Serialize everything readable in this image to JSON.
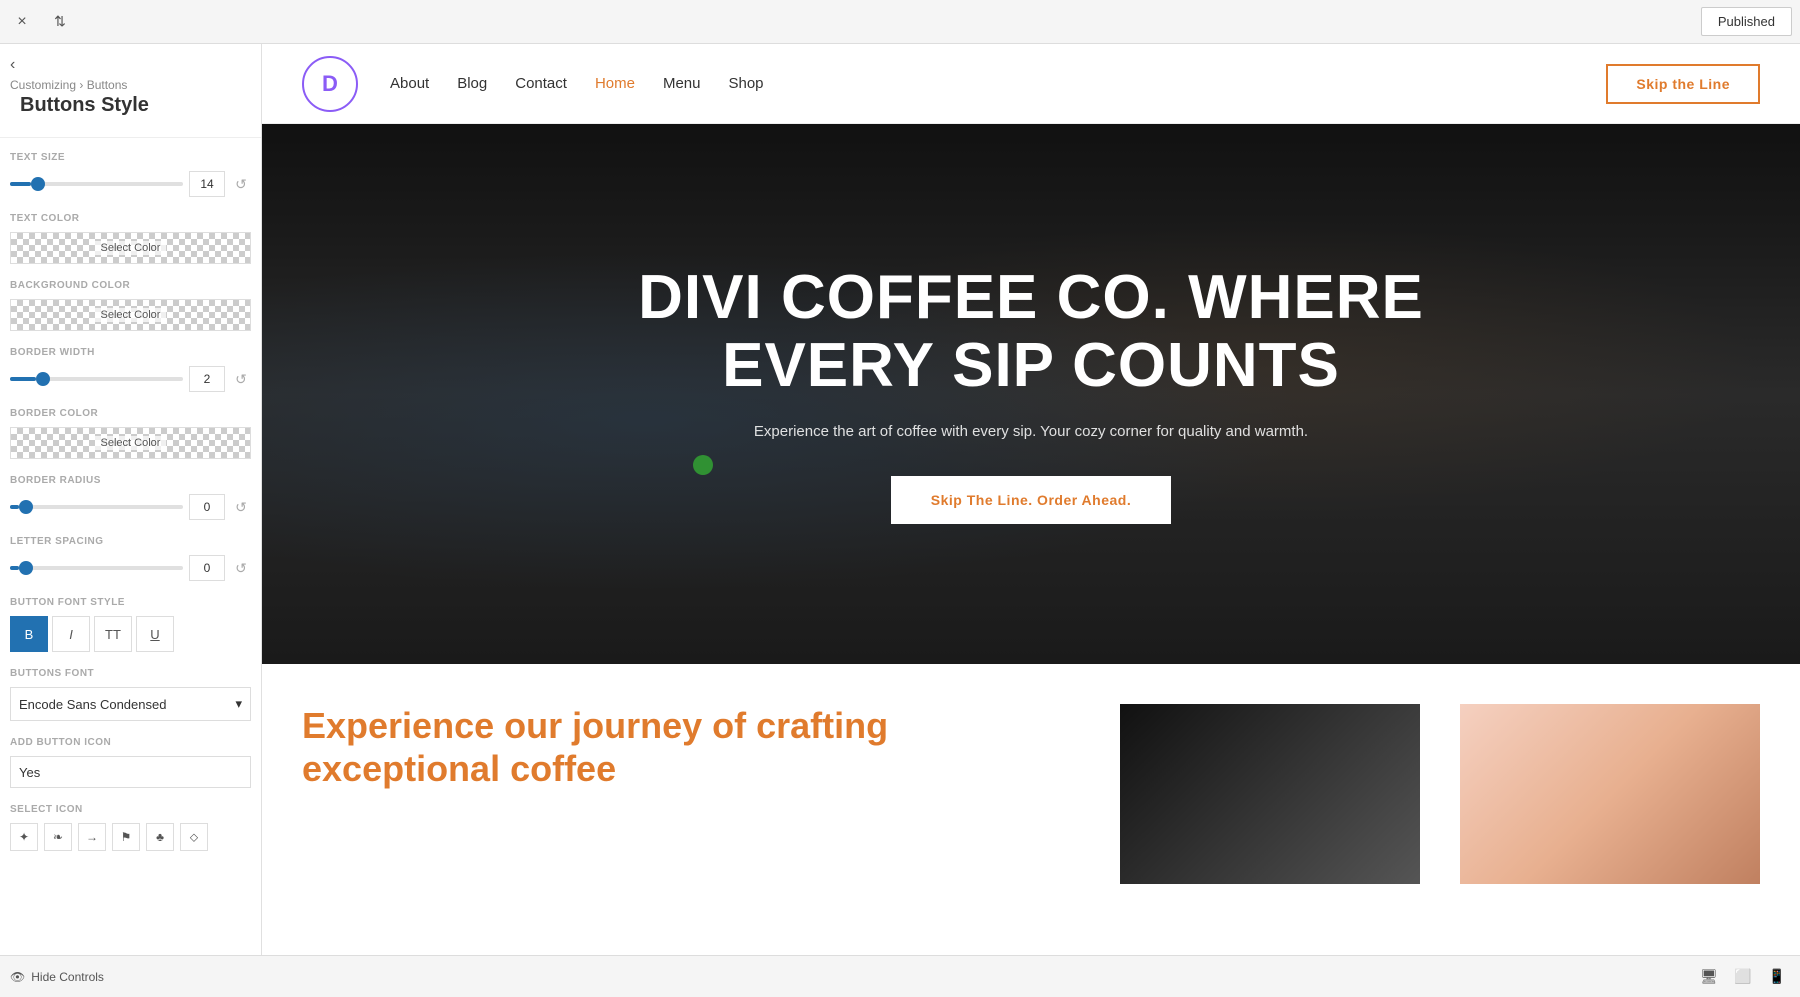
{
  "toolbar": {
    "close_label": "×",
    "arrows_label": "⇅",
    "published_label": "Published"
  },
  "panel": {
    "back_arrow": "‹",
    "breadcrumb": "Customizing › Buttons",
    "title": "Buttons Style",
    "sections": {
      "text_size": {
        "label": "TEXT SIZE",
        "value": "14",
        "slider_percent": 12
      },
      "text_color": {
        "label": "TEXT COLOR",
        "swatch_label": "Select Color"
      },
      "background_color": {
        "label": "BACKGROUND COLOR",
        "swatch_label": "Select Color"
      },
      "border_width": {
        "label": "BORDER WIDTH",
        "value": "2",
        "slider_percent": 15
      },
      "border_color": {
        "label": "BORDER COLOR",
        "swatch_label": "Select Color"
      },
      "border_radius": {
        "label": "BORDER RADIUS",
        "value": "0",
        "slider_percent": 5
      },
      "letter_spacing": {
        "label": "LETTER SPACING",
        "value": "0",
        "slider_percent": 5
      },
      "button_font_style": {
        "label": "BUTTON FONT STYLE",
        "bold": "B",
        "italic": "I",
        "all_caps": "TT",
        "underline": "U"
      },
      "buttons_font": {
        "label": "BUTTONS FONT",
        "value": "Encode Sans Condensed",
        "arrow": "▾"
      },
      "add_button_icon": {
        "label": "ADD BUTTON ICON",
        "value": "Yes"
      },
      "select_icon": {
        "label": "SELECT ICON"
      }
    }
  },
  "bottom_bar": {
    "hide_controls": "Hide Controls",
    "desktop_icon": "🖥",
    "tablet_icon": "⬜",
    "mobile_icon": "📱"
  },
  "site": {
    "nav": {
      "logo": "D",
      "links": [
        "About",
        "Blog",
        "Contact",
        "Home",
        "Menu",
        "Shop"
      ],
      "active_link": "Home",
      "cta_button": "Skip the Line"
    },
    "hero": {
      "title": "DIVI COFFEE CO. WHERE EVERY SIP COUNTS",
      "subtitle": "Experience the art of coffee with every sip. Your cozy corner for quality and warmth.",
      "cta_button": "Skip The Line. Order Ahead."
    },
    "below": {
      "title": "Experience our journey of crafting exceptional coffee"
    }
  }
}
